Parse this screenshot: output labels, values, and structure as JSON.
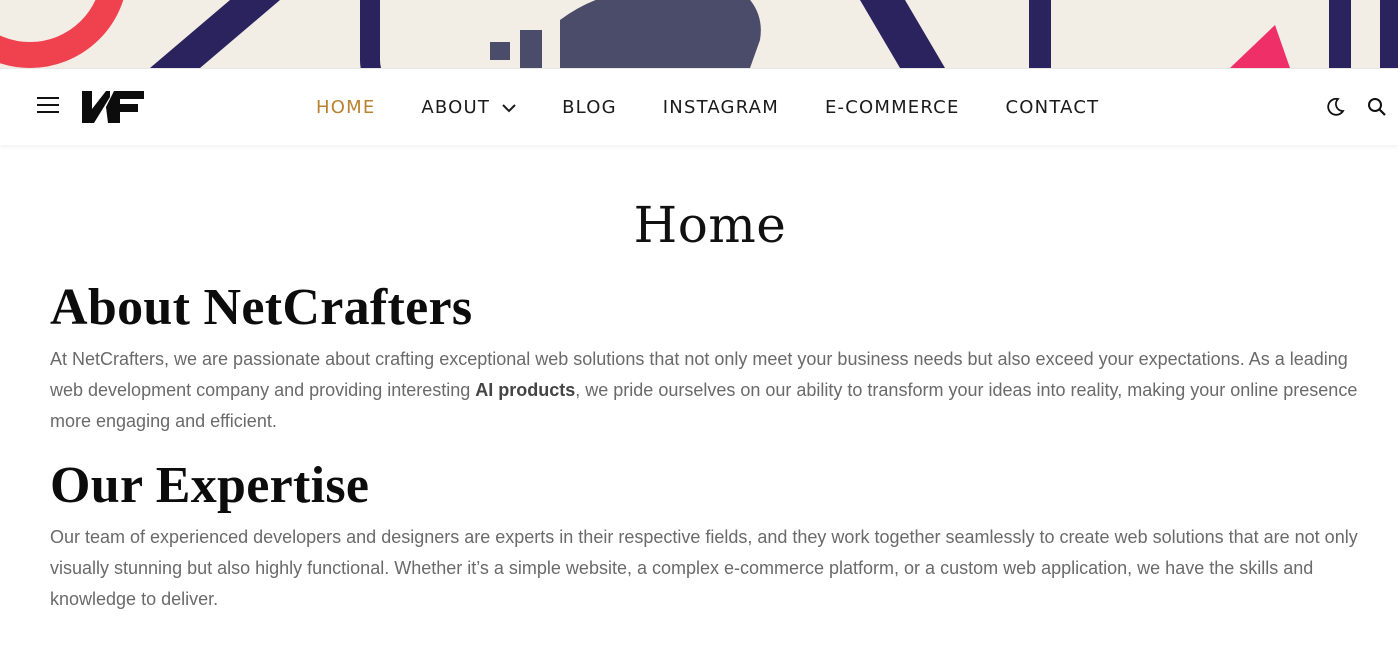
{
  "header": {
    "logo_text": "NF",
    "nav_items": [
      {
        "label": "HOME",
        "active": true
      },
      {
        "label": "ABOUT",
        "has_dropdown": true
      },
      {
        "label": "BLOG"
      },
      {
        "label": "INSTAGRAM"
      },
      {
        "label": "E-COMMERCE"
      },
      {
        "label": "CONTACT"
      }
    ],
    "icons": [
      "menu-icon",
      "moon-icon",
      "search-icon"
    ],
    "accent_color": "#b98131"
  },
  "page": {
    "title": "Home",
    "sections": [
      {
        "heading": "About NetCrafters",
        "text_before": "At NetCrafters, we are passionate about crafting exceptional web solutions that not only meet your business needs but also exceed your expectations. As a leading web development company and providing interesting ",
        "text_bold": "AI products",
        "text_after": ", we pride ourselves on our ability to transform your ideas into reality, making your online presence more engaging and efficient."
      },
      {
        "heading": "Our Expertise",
        "text": "Our team of experienced developers and designers are experts in their respective fields, and they work together seamlessly to create web solutions that are not only visually stunning but also highly functional. Whether it’s a simple website, a complex e-commerce platform, or a custom web application, we have the skills and knowledge to deliver."
      }
    ]
  }
}
